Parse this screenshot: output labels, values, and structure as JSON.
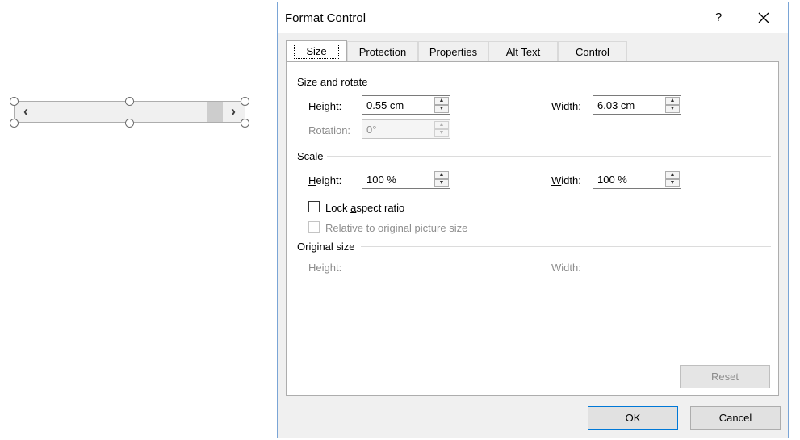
{
  "dialog": {
    "title": "Format Control",
    "help_label": "?",
    "tabs": [
      "Size",
      "Protection",
      "Properties",
      "Alt Text",
      "Control"
    ],
    "size_rotate": {
      "heading": "Size and rotate",
      "height_label_pre": "H",
      "height_label_key": "e",
      "height_label_post": "ight:",
      "height_value": "0.55 cm",
      "width_label_pre": "Wi",
      "width_label_key": "d",
      "width_label_post": "th:",
      "width_value": "6.03 cm",
      "rotation_label": "Rotation:",
      "rotation_value": "0°"
    },
    "scale": {
      "heading": "Scale",
      "height_label_key": "H",
      "height_label_post": "eight:",
      "height_value": "100 %",
      "width_label_key": "W",
      "width_label_post": "idth:",
      "width_value": "100 %",
      "lock_pre": "Lock ",
      "lock_key": "a",
      "lock_post": "spect ratio",
      "relative_label": "Relative to original picture size"
    },
    "original_size": {
      "heading": "Original size",
      "height_label": "Height:",
      "width_label": "Width:"
    },
    "reset_label": "Reset",
    "ok_label": "OK",
    "cancel_label": "Cancel"
  },
  "scrollbar_control": {
    "left_arrow": "‹",
    "right_arrow": "›"
  }
}
